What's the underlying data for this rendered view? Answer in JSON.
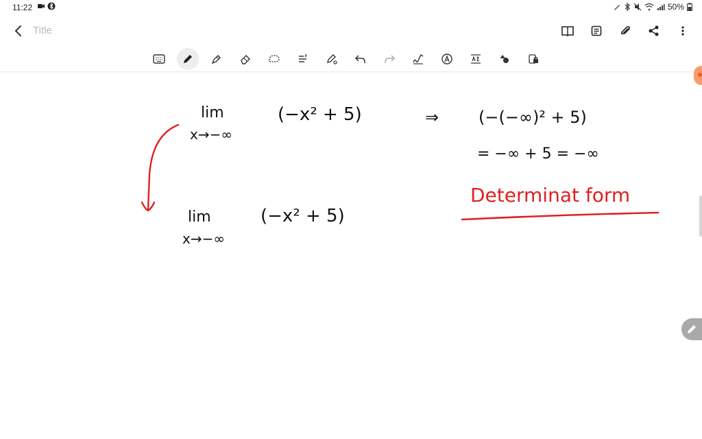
{
  "statusbar": {
    "time": "11:22",
    "battery": "50%"
  },
  "appbar": {
    "title": "Title",
    "actions": [
      "book-icon",
      "text-icon",
      "attach-icon",
      "share-icon",
      "more-icon"
    ]
  },
  "toolbar": {
    "tools": [
      "keyboard-icon",
      "pen-icon",
      "highlighter-icon",
      "eraser-icon",
      "lasso-icon",
      "text-format-icon",
      "pen-settings-icon",
      "undo-icon",
      "redo-icon",
      "handwriting-icon",
      "font-icon",
      "spacing-icon",
      "shapes-icon",
      "lock-icon"
    ],
    "selected": "pen-icon"
  },
  "canvas": {
    "ink_black": "#111111",
    "ink_red": "#e02020",
    "notes": {
      "lim1": "lim",
      "sub1": "x→−∞",
      "expr1": "(−x² + 5)",
      "arrow": "⇒",
      "line1": "(−(−∞)² + 5)",
      "line2": "= −∞ + 5 = −∞",
      "red_text": "Determinat form",
      "lim2": "lim",
      "sub2": "x→−∞",
      "expr2": "(−x² + 5)"
    }
  },
  "colors": {
    "toolbar_selected_bg": "#eeeeee",
    "fab_bg": "#a9a9a9",
    "orange_handle": "#f79a6c"
  }
}
